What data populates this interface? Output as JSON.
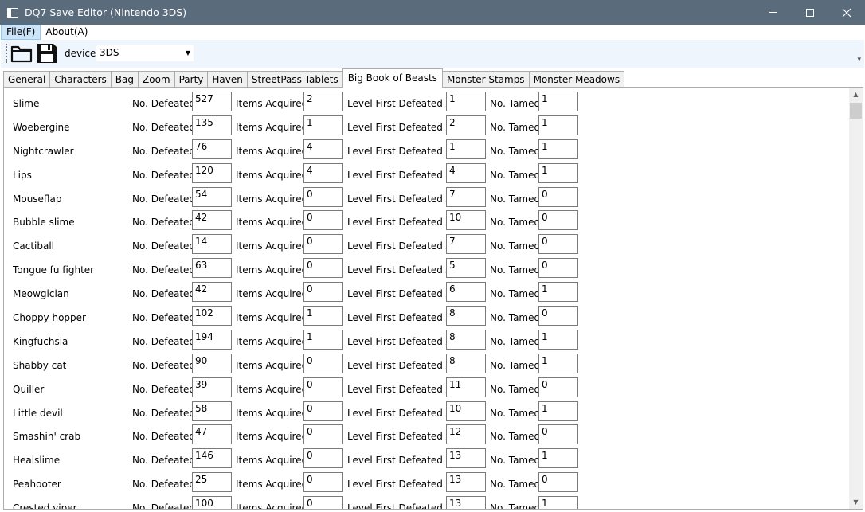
{
  "window": {
    "title": "DQ7 Save Editor (Nintendo 3DS)"
  },
  "menu": {
    "file": "File(F)",
    "about": "About(A)"
  },
  "toolbar": {
    "device_label": "device",
    "device_value": "3DS"
  },
  "tabs": [
    "General",
    "Characters",
    "Bag",
    "Zoom",
    "Party",
    "Haven",
    "StreetPass Tablets",
    "Big Book of Beasts",
    "Monster Stamps",
    "Monster Meadows"
  ],
  "selected_tab": "Big Book of Beasts",
  "labels": {
    "defeated": "No. Defeated",
    "items": "Items Acquired",
    "level": "Level First Defeated At",
    "tamed": "No. Tamed"
  },
  "beasts": [
    {
      "name": "Slime",
      "defeated": "527",
      "items": "2",
      "level": "1",
      "tamed": "1"
    },
    {
      "name": "Woebergine",
      "defeated": "135",
      "items": "1",
      "level": "2",
      "tamed": "1"
    },
    {
      "name": "Nightcrawler",
      "defeated": "76",
      "items": "4",
      "level": "1",
      "tamed": "1"
    },
    {
      "name": "Lips",
      "defeated": "120",
      "items": "4",
      "level": "4",
      "tamed": "1"
    },
    {
      "name": "Mouseflap",
      "defeated": "54",
      "items": "0",
      "level": "7",
      "tamed": "0"
    },
    {
      "name": "Bubble slime",
      "defeated": "42",
      "items": "0",
      "level": "10",
      "tamed": "0"
    },
    {
      "name": "Cactiball",
      "defeated": "14",
      "items": "0",
      "level": "7",
      "tamed": "0"
    },
    {
      "name": "Tongue fu fighter",
      "defeated": "63",
      "items": "0",
      "level": "5",
      "tamed": "0"
    },
    {
      "name": "Meowgician",
      "defeated": "42",
      "items": "0",
      "level": "6",
      "tamed": "1"
    },
    {
      "name": "Choppy hopper",
      "defeated": "102",
      "items": "1",
      "level": "8",
      "tamed": "0"
    },
    {
      "name": "Kingfuchsia",
      "defeated": "194",
      "items": "1",
      "level": "8",
      "tamed": "1"
    },
    {
      "name": "Shabby cat",
      "defeated": "90",
      "items": "0",
      "level": "8",
      "tamed": "1"
    },
    {
      "name": "Quiller",
      "defeated": "39",
      "items": "0",
      "level": "11",
      "tamed": "0"
    },
    {
      "name": "Little devil",
      "defeated": "58",
      "items": "0",
      "level": "10",
      "tamed": "1"
    },
    {
      "name": "Smashin' crab",
      "defeated": "47",
      "items": "0",
      "level": "12",
      "tamed": "0"
    },
    {
      "name": "Healslime",
      "defeated": "146",
      "items": "0",
      "level": "13",
      "tamed": "1"
    },
    {
      "name": "Peahooter",
      "defeated": "25",
      "items": "0",
      "level": "13",
      "tamed": "0"
    },
    {
      "name": "Crested viper",
      "defeated": "100",
      "items": "0",
      "level": "13",
      "tamed": "1"
    }
  ]
}
